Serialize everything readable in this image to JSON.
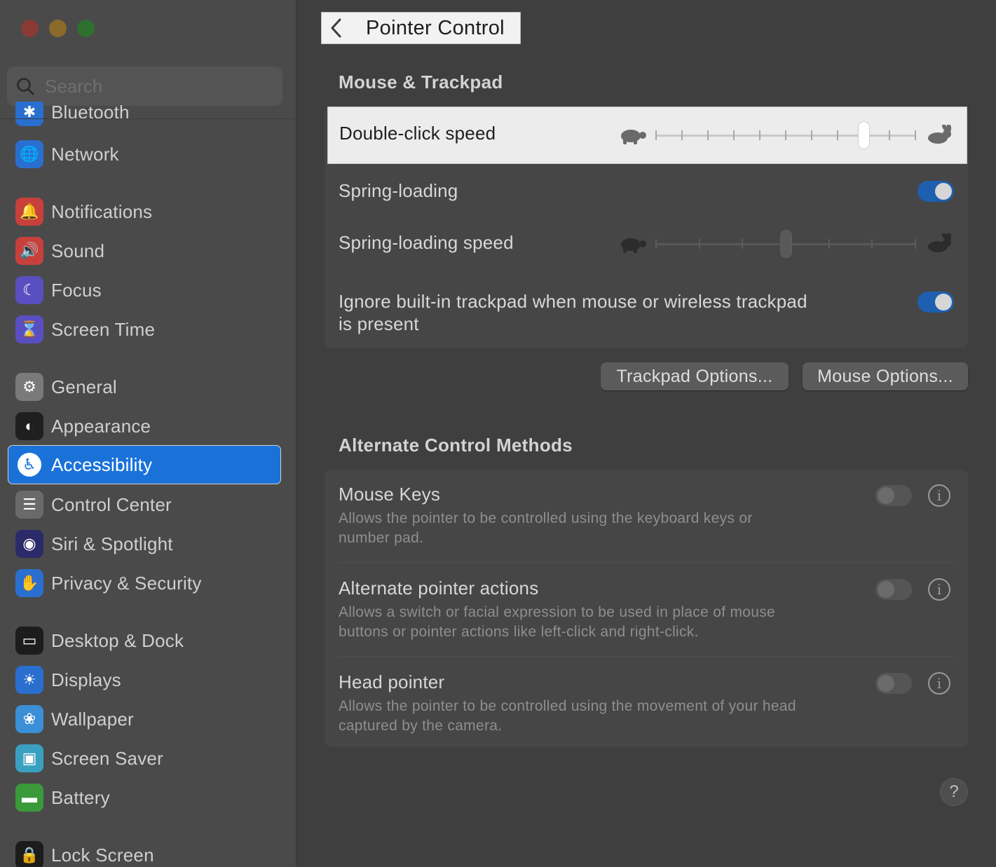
{
  "window": {
    "title": "Pointer Control"
  },
  "sidebar": {
    "search_placeholder": "Search",
    "partial_item": "Bluetooth",
    "items": [
      {
        "label": "Network",
        "icon": "globe-icon",
        "color": "#2a6fcf"
      },
      {
        "label": "Notifications",
        "icon": "bell-icon",
        "color": "#c8403c"
      },
      {
        "label": "Sound",
        "icon": "speaker-icon",
        "color": "#c8403c"
      },
      {
        "label": "Focus",
        "icon": "moon-icon",
        "color": "#5a4fc0"
      },
      {
        "label": "Screen Time",
        "icon": "hourglass-icon",
        "color": "#5a4fc0"
      },
      {
        "label": "General",
        "icon": "gear-icon",
        "color": "#7a7a7a"
      },
      {
        "label": "Appearance",
        "icon": "appearance-icon",
        "color": "#1f1f1f"
      },
      {
        "label": "Accessibility",
        "icon": "accessibility-icon",
        "color": "#1a72d9"
      },
      {
        "label": "Control Center",
        "icon": "control-center-icon",
        "color": "#6a6a6a"
      },
      {
        "label": "Siri & Spotlight",
        "icon": "siri-icon",
        "color": "#2b2b6a"
      },
      {
        "label": "Privacy & Security",
        "icon": "hand-icon",
        "color": "#2a6fcf"
      },
      {
        "label": "Desktop & Dock",
        "icon": "dock-icon",
        "color": "#1c1c1c"
      },
      {
        "label": "Displays",
        "icon": "sun-icon",
        "color": "#2a6fcf"
      },
      {
        "label": "Wallpaper",
        "icon": "flower-icon",
        "color": "#3a8fd6"
      },
      {
        "label": "Screen Saver",
        "icon": "screensaver-icon",
        "color": "#3aa0c0"
      },
      {
        "label": "Battery",
        "icon": "battery-icon",
        "color": "#3a9a3a"
      },
      {
        "label": "Lock Screen",
        "icon": "lock-icon",
        "color": "#1c1c1c"
      }
    ],
    "active": "Accessibility"
  },
  "mouse_trackpad": {
    "section_title": "Mouse & Trackpad",
    "double_click_speed": {
      "label": "Double-click speed",
      "value": 0.8,
      "ticks": 11
    },
    "spring_loading": {
      "label": "Spring-loading",
      "on": true
    },
    "spring_loading_speed": {
      "label": "Spring-loading speed",
      "value": 0.5,
      "ticks": 7
    },
    "ignore_trackpad": {
      "label_line1": "Ignore built-in trackpad when mouse or wireless trackpad",
      "label_line2": "is present",
      "on": true
    },
    "trackpad_options_button": "Trackpad Options...",
    "mouse_options_button": "Mouse Options..."
  },
  "alternate_methods": {
    "section_title": "Alternate Control Methods",
    "items": [
      {
        "label": "Mouse Keys",
        "desc_line1": "Allows the pointer to be controlled using the keyboard keys or",
        "desc_line2": "number pad.",
        "on": false
      },
      {
        "label": "Alternate pointer actions",
        "desc_line1": "Allows a switch or facial expression to be used in place of mouse",
        "desc_line2": "buttons or pointer actions like left-click and right-click.",
        "on": false
      },
      {
        "label": "Head pointer",
        "desc_line1": "Allows the pointer to be controlled using the movement of your head",
        "desc_line2": "captured by the camera.",
        "on": false
      }
    ]
  },
  "help_label": "?",
  "info_glyph": "i"
}
